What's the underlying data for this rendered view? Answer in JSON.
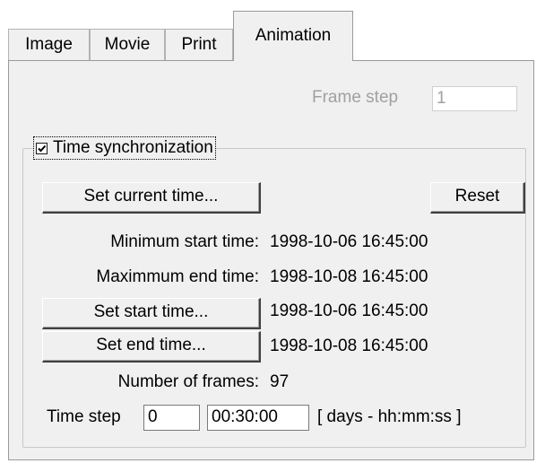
{
  "tabs": [
    {
      "label": "Image",
      "active": false
    },
    {
      "label": "Movie",
      "active": false
    },
    {
      "label": "Print",
      "active": false
    },
    {
      "label": "Animation",
      "active": true
    }
  ],
  "frame_step": {
    "label": "Frame step",
    "value": "1",
    "enabled": false
  },
  "time_sync": {
    "label": "Time synchronization",
    "checked": true
  },
  "buttons": {
    "set_current_time": "Set current time...",
    "reset": "Reset",
    "set_start_time": "Set start time...",
    "set_end_time": "Set end time..."
  },
  "info": {
    "min_start_label": "Minimum start time:",
    "min_start_value": "1998-10-06 16:45:00",
    "max_end_label": "Maximmum end time:",
    "max_end_value": "1998-10-08 16:45:00",
    "start_value": "1998-10-06 16:45:00",
    "end_value": "1998-10-08 16:45:00",
    "frames_label": "Number of frames:",
    "frames_value": "97"
  },
  "time_step": {
    "label": "Time step",
    "days": "0",
    "hms": "00:30:00",
    "format_hint": "[ days - hh:mm:ss ]"
  }
}
